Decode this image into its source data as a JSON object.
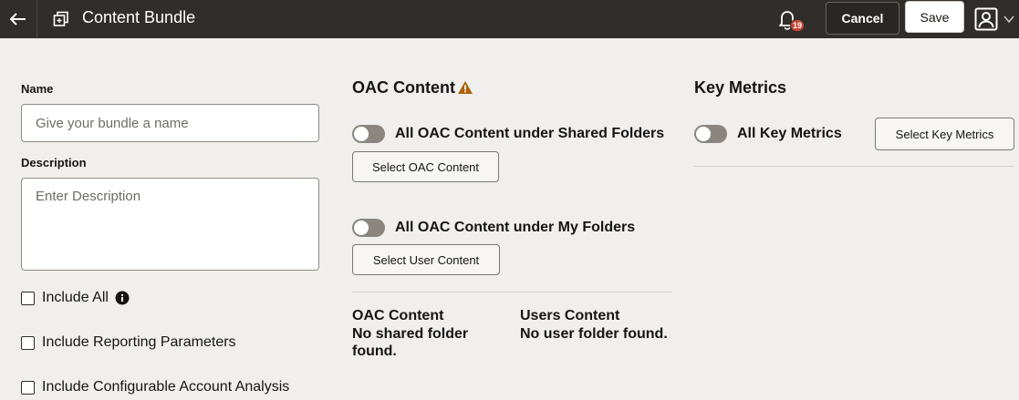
{
  "header": {
    "title": "Content Bundle",
    "notification_count": "19",
    "cancel_label": "Cancel",
    "save_label": "Save"
  },
  "form": {
    "name_label": "Name",
    "name_placeholder": "Give your bundle a name",
    "description_label": "Description",
    "description_placeholder": "Enter Description",
    "checkboxes": [
      {
        "label": "Include All",
        "checked": false
      },
      {
        "label": "Include Reporting Parameters",
        "checked": false
      },
      {
        "label": "Include Configurable Account Analysis",
        "checked": false
      }
    ]
  },
  "oac": {
    "title": "OAC Content",
    "shared_toggle_label": "All OAC Content under Shared Folders",
    "shared_toggle_on": false,
    "select_oac_label": "Select OAC Content",
    "my_toggle_label": "All OAC Content under My Folders",
    "my_toggle_on": false,
    "select_user_label": "Select User Content",
    "oac_content_head": "OAC Content",
    "oac_content_msg": "No shared folder found.",
    "users_content_head": "Users Content",
    "users_content_msg": "No user folder found."
  },
  "metrics": {
    "title": "Key Metrics",
    "toggle_label": "All Key Metrics",
    "toggle_on": false,
    "select_label": "Select Key Metrics"
  },
  "colors": {
    "header_bg": "#312d2a",
    "page_bg": "#f1efed",
    "badge": "#c74634",
    "warning": "#ac630c"
  }
}
